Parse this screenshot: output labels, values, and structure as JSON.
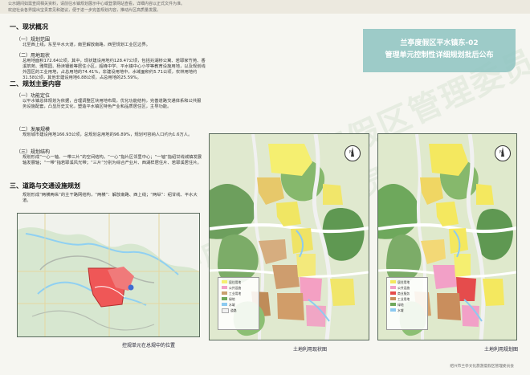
{
  "header": {
    "line1": "公示期间如需查阅相关资料，请前往水镇规划展示中心或登录网站查看，详细内容以正式文件为准。",
    "line2": "欢迎社会各界提出宝贵意见和建议，便于进一步完善规划内容，推动片区高质量发展。"
  },
  "left": {
    "sec1": "一、现状概况",
    "s1_1": "（一）规划范围",
    "p1_1": "北至西上线，东至平水大道，南至解放南路，西至规划工业区边界。",
    "s1_2": "（二）用地现状",
    "p1_2": "总用地面积172.64公顷，其中，现状建设用地约128.47公顷，包括兆湖桥公寓、若耶家竹苑、香溪筑苑、雅鹭园、杨渎镶嵌等居住小区，超峰中学、平水镇中心小学等教育设施用地，以及规划线外园区的工业用地，占总用地的74.41%，非建设用地中，水域面积约5.71公顷，农林用地约31.58公顷，其他非建设用地6.88公顷，占总用地的25.59%。",
    "sec2": "二、规划主要内容",
    "s2_1": "（一）功能定位",
    "p2_1": "以平水镇总体规划为依据，合理调整区块用地布局，优化功能结构，完善道路交通体系和公共服务设施配套，凸显历史文化，塑造平水镇区特色产业和品质居住区，主导功能。",
    "s2_2": "（二）发展规模",
    "p2_2": "规划城市建设用地166.93公顷，总规划总用地的96.89%，规划可容纳人口约为1.6万人。",
    "s2_3": "（三）规划结构",
    "p2_3": "规划形成“一心一轴、一带三片”的空间结构。“一心”指片区邻里中心；“一轴”指绍甘线城镇发展轴发展轴；“一带”指若耶溪风光带；“三片”分别为综合产业片、西湖样居住片、若耶溪居住片。",
    "sec3": "三、道路与交通设施规划",
    "p3_1": "规划形成“两横两纵”的主干路网结构，“两横”：解放南路、西上线；“两纵”：绍甘线、平水大道。",
    "inset_caption": "控规单元在总规中的位置"
  },
  "banner": {
    "title1": "兰亭度假区平水镇东-02",
    "title2": "管理单元控制性详细规划批后公布"
  },
  "maps": {
    "left_caption": "土地利用现状图",
    "right_caption": "土地利用规划图"
  },
  "footer": {
    "note": "绍兴市兰亭文化旅游度假区管理委员会"
  },
  "watermarks": {
    "w1": "兰亭度假区管理委员会",
    "w2": "兰亭度假区管理委员会"
  },
  "colors": {
    "accent": "#8fc5c2",
    "residential": "#f4e85f",
    "industrial": "#c9a06f",
    "public": "#f2a0c7",
    "green": "#6ea85c",
    "water": "#8ccaf0",
    "road": "#f2f2f2",
    "red": "#e54c4c"
  }
}
